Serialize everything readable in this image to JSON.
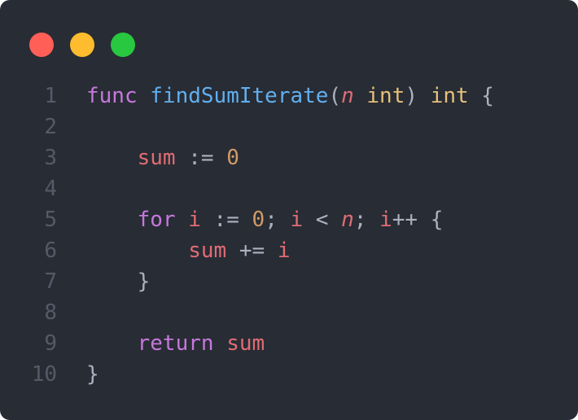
{
  "window": {
    "controls": {
      "close_color": "#ff5f57",
      "minimize_color": "#febc2e",
      "maximize_color": "#28c840"
    }
  },
  "code": {
    "lines": [
      {
        "number": "1",
        "tokens": [
          {
            "t": "func",
            "c": "kw"
          },
          {
            "t": " ",
            "c": "punc"
          },
          {
            "t": "findSumIterate",
            "c": "fn"
          },
          {
            "t": "(",
            "c": "punc"
          },
          {
            "t": "n",
            "c": "param"
          },
          {
            "t": " ",
            "c": "punc"
          },
          {
            "t": "int",
            "c": "type"
          },
          {
            "t": ") ",
            "c": "punc"
          },
          {
            "t": "int",
            "c": "type"
          },
          {
            "t": " {",
            "c": "punc"
          }
        ]
      },
      {
        "number": "2",
        "tokens": []
      },
      {
        "number": "3",
        "tokens": [
          {
            "t": "    ",
            "c": "punc"
          },
          {
            "t": "sum",
            "c": "var"
          },
          {
            "t": " := ",
            "c": "op"
          },
          {
            "t": "0",
            "c": "num"
          }
        ]
      },
      {
        "number": "4",
        "tokens": []
      },
      {
        "number": "5",
        "tokens": [
          {
            "t": "    ",
            "c": "punc"
          },
          {
            "t": "for",
            "c": "kw"
          },
          {
            "t": " ",
            "c": "punc"
          },
          {
            "t": "i",
            "c": "var"
          },
          {
            "t": " := ",
            "c": "op"
          },
          {
            "t": "0",
            "c": "num"
          },
          {
            "t": "; ",
            "c": "punc"
          },
          {
            "t": "i",
            "c": "var"
          },
          {
            "t": " < ",
            "c": "op"
          },
          {
            "t": "n",
            "c": "param"
          },
          {
            "t": "; ",
            "c": "punc"
          },
          {
            "t": "i",
            "c": "var"
          },
          {
            "t": "++",
            "c": "op"
          },
          {
            "t": " {",
            "c": "punc"
          }
        ]
      },
      {
        "number": "6",
        "tokens": [
          {
            "t": "        ",
            "c": "punc"
          },
          {
            "t": "sum",
            "c": "var"
          },
          {
            "t": " += ",
            "c": "op"
          },
          {
            "t": "i",
            "c": "var"
          }
        ]
      },
      {
        "number": "7",
        "tokens": [
          {
            "t": "    ",
            "c": "punc"
          },
          {
            "t": "}",
            "c": "punc"
          }
        ]
      },
      {
        "number": "8",
        "tokens": []
      },
      {
        "number": "9",
        "tokens": [
          {
            "t": "    ",
            "c": "punc"
          },
          {
            "t": "return",
            "c": "kw"
          },
          {
            "t": " ",
            "c": "punc"
          },
          {
            "t": "sum",
            "c": "var"
          }
        ]
      },
      {
        "number": "10",
        "tokens": [
          {
            "t": "}",
            "c": "punc"
          }
        ]
      }
    ]
  }
}
